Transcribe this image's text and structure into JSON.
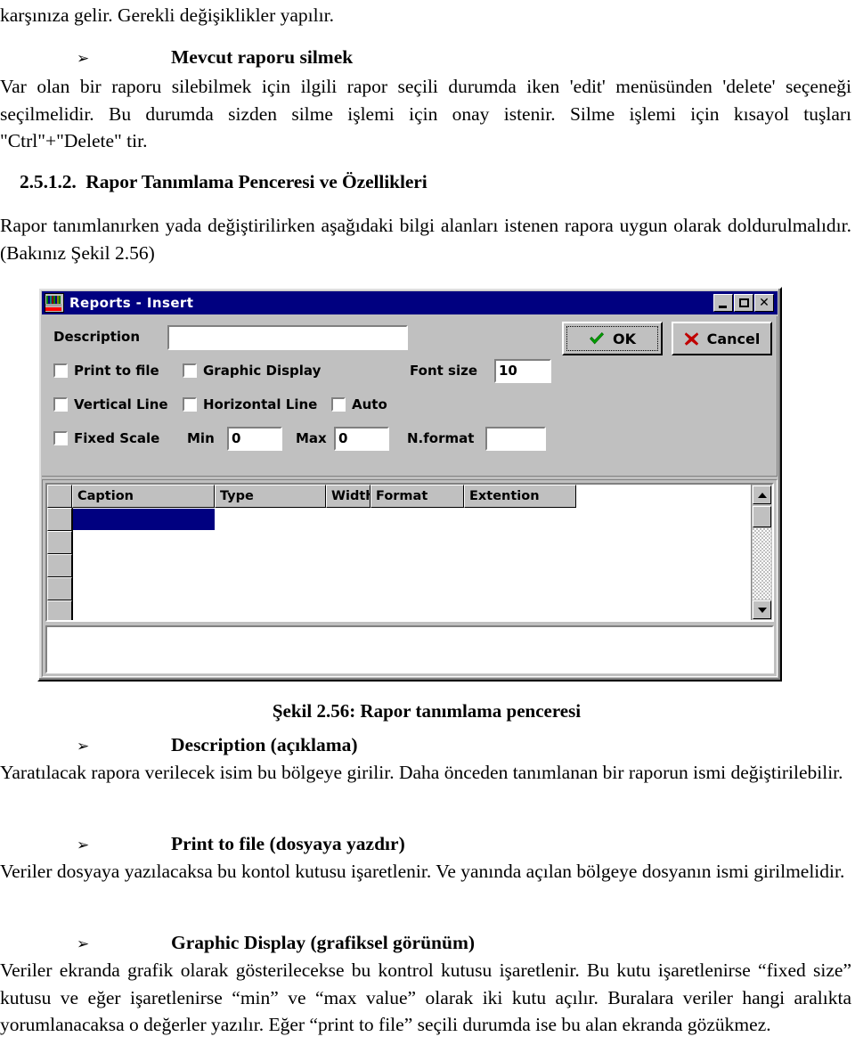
{
  "document": {
    "top_paragraph": "karşınıza gelir. Gerekli değişiklikler yapılır.",
    "bullet1": "Mevcut raporu silmek",
    "paragraph1": "Var olan bir raporu silebilmek için ilgili rapor seçili durumda iken 'edit' menüsünden 'delete' seçeneği seçilmelidir. Bu durumda sizden silme işlemi için onay istenir. Silme işlemi için kısayol tuşları \"Ctrl\"+\"Delete\" tir.",
    "section_number": "2.5.1.2.",
    "section_title": "Rapor Tanımlama Penceresi ve Özellikleri",
    "paragraph2": "Rapor tanımlanırken yada değiştirilirken aşağıdaki bilgi alanları istenen rapora uygun olarak doldurulmalıdır. (Bakınız Şekil 2.56)",
    "figure_caption": "Şekil 2.56: Rapor tanımlama penceresi",
    "bullet2": "Description (açıklama)",
    "paragraph3": "Yaratılacak rapora verilecek isim bu bölgeye girilir. Daha önceden tanımlanan bir raporun ismi değiştirilebilir.",
    "bullet3": "Print to file (dosyaya yazdır)",
    "paragraph4": "Veriler dosyaya yazılacaksa bu kontol kutusu işaretlenir. Ve yanında açılan bölgeye dosyanın ismi girilmelidir.",
    "bullet4": "Graphic Display (grafiksel görünüm)",
    "paragraph5": "Veriler ekranda grafik olarak gösterilecekse bu kontrol kutusu işaretlenir. Bu kutu işaretlenirse “fixed size” kutusu ve eğer işaretlenirse “min” ve “max value” olarak iki kutu açılır. Buralara veriler hangi aralıkta yorumlanacaksa o değerler yazılır. Eğer “print to file” seçili durumda ise bu alan ekranda gözükmez.",
    "bullet_glyph": "➢"
  },
  "dialog": {
    "title": "Reports - Insert",
    "title_icon": "report-app-icon",
    "window_buttons": {
      "minimize": "minimize-icon",
      "maximize": "maximize-icon",
      "close": "close-icon"
    },
    "fields": {
      "description_label": "Description",
      "description_value": "",
      "font_size_label": "Font size",
      "font_size_value": "10",
      "min_label": "Min",
      "min_value": "0",
      "max_label": "Max",
      "max_value": "0",
      "nformat_label": "N.format",
      "nformat_value": ""
    },
    "checkboxes": [
      {
        "label": "Print to file",
        "checked": false
      },
      {
        "label": "Graphic Display",
        "checked": false
      },
      {
        "label": "Vertical Line",
        "checked": false
      },
      {
        "label": "Horizontal Line",
        "checked": false
      },
      {
        "label": "Auto",
        "checked": false
      },
      {
        "label": "Fixed Scale",
        "checked": false
      }
    ],
    "buttons": {
      "ok": "OK",
      "cancel": "Cancel",
      "ok_icon": "green-check-icon",
      "cancel_icon": "red-x-icon"
    },
    "grid": {
      "columns": [
        "Caption",
        "Type",
        "Width",
        "Format",
        "Extention"
      ],
      "rows": [
        {
          "Caption": "",
          "Type": "",
          "Width": "",
          "Format": "",
          "Extention": ""
        },
        {
          "Caption": "",
          "Type": "",
          "Width": "",
          "Format": "",
          "Extention": ""
        },
        {
          "Caption": "",
          "Type": "",
          "Width": "",
          "Format": "",
          "Extention": ""
        },
        {
          "Caption": "",
          "Type": "",
          "Width": "",
          "Format": "",
          "Extention": ""
        },
        {
          "Caption": "",
          "Type": "",
          "Width": "",
          "Format": "",
          "Extention": ""
        }
      ],
      "selected_row_index": 0,
      "selected_column": "Caption"
    },
    "colors": {
      "titlebar": "#000080",
      "face": "#c0c0c0",
      "selection": "#000080",
      "ok_check": "#00a000",
      "cancel_x": "#c00000"
    }
  }
}
